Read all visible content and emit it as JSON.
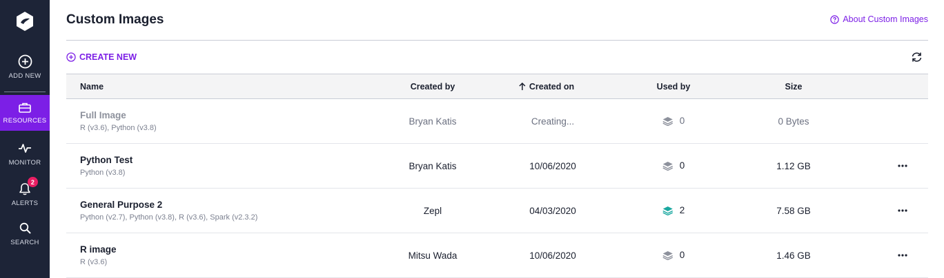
{
  "sidebar": {
    "items": [
      {
        "label": "ADD NEW",
        "icon": "plus-circle-icon"
      },
      {
        "label": "RESOURCES",
        "icon": "briefcase-icon"
      },
      {
        "label": "MONITOR",
        "icon": "pulse-icon"
      },
      {
        "label": "ALERTS",
        "icon": "bell-icon",
        "badge": "2"
      },
      {
        "label": "SEARCH",
        "icon": "search-icon"
      }
    ]
  },
  "header": {
    "title": "Custom Images",
    "about_link": "About Custom Images"
  },
  "toolbar": {
    "create_label": "CREATE NEW"
  },
  "table": {
    "columns": [
      "Name",
      "Created by",
      "Created on",
      "Used by",
      "Size"
    ],
    "sorted_column": "Created on",
    "rows": [
      {
        "name": "Full Image",
        "sub": "R (v3.6), Python (v3.8)",
        "created_by": "Bryan Katis",
        "created_on": "Creating...",
        "used_by": "0",
        "size": "0 Bytes",
        "status": "creating"
      },
      {
        "name": "Python Test",
        "sub": "Python (v3.8)",
        "created_by": "Bryan Katis",
        "created_on": "10/06/2020",
        "used_by": "0",
        "size": "1.12 GB",
        "status": "ready"
      },
      {
        "name": "General Purpose 2",
        "sub": "Python (v2.7), Python (v3.8), R (v3.6), Spark (v2.3.2)",
        "created_by": "Zepl",
        "created_on": "04/03/2020",
        "used_by": "2",
        "size": "7.58 GB",
        "status": "ready"
      },
      {
        "name": "R image",
        "sub": "R (v3.6)",
        "created_by": "Mitsu Wada",
        "created_on": "10/06/2020",
        "used_by": "0",
        "size": "1.46 GB",
        "status": "ready"
      }
    ]
  },
  "colors": {
    "sidebar_bg": "#1d2437",
    "accent": "#7c1fe6",
    "badge": "#e91e63",
    "used_teal": "#1aa8a0"
  }
}
